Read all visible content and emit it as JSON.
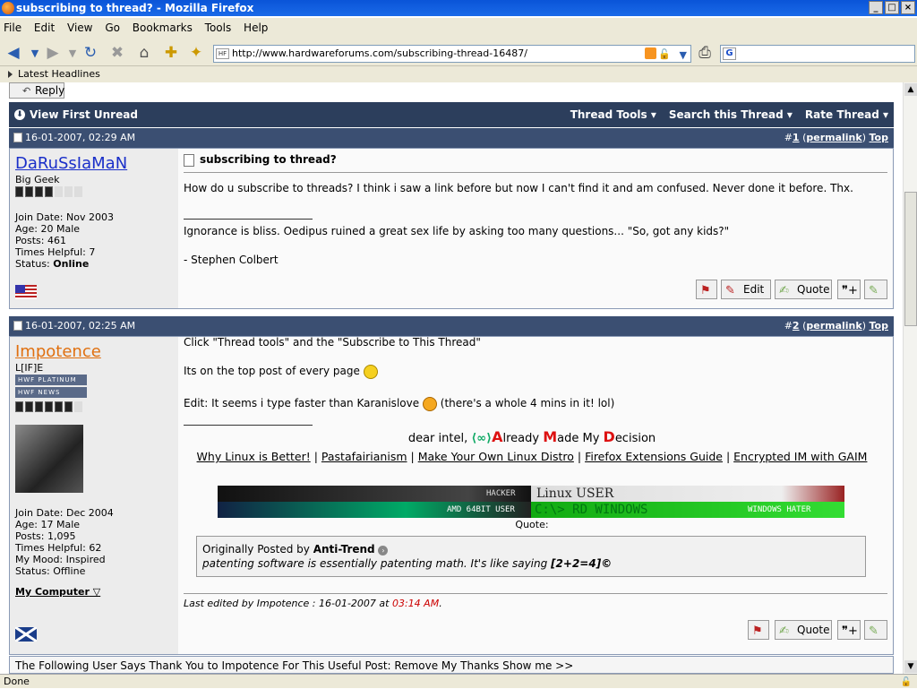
{
  "window": {
    "title": "subscribing to thread? - Mozilla Firefox"
  },
  "menu": [
    "File",
    "Edit",
    "View",
    "Go",
    "Bookmarks",
    "Tools",
    "Help"
  ],
  "address": {
    "url": "http://www.hardwareforums.com/subscribing-thread-16487/",
    "site_icon": "HF"
  },
  "search": {
    "engine_icon": "G",
    "value": ""
  },
  "bookmarks_bar": {
    "item": "Latest Headlines"
  },
  "toolbar": {
    "reply": "Reply"
  },
  "threadbar": {
    "view_first_unread": "View First Unread",
    "thread_tools": "Thread Tools",
    "search_thread": "Search this Thread",
    "rate_thread": "Rate Thread"
  },
  "posts": [
    {
      "date": "16-01-2007, 02:29 AM",
      "number": "1",
      "permalink": "permalink",
      "top": "Top",
      "username": "DaRuSsIaMaN",
      "user_title": "Big Geek",
      "rep_on": 4,
      "rep_total": 7,
      "join": "Join Date: Nov 2003",
      "age": "Age: 20 Male",
      "posts": "Posts: 461",
      "helpful": "Times Helpful: 7",
      "status_label": "Status:",
      "status": "Online",
      "subject": "subscribing to thread?",
      "body": "How do u subscribe to threads? I think i saw a link before but now I can't find it and am confused. Never done it before. Thx.",
      "sig_line1": "Ignorance is bliss. Oedipus ruined a great sex life by asking too many questions... \"So, got any kids?\"",
      "sig_line2": "- Stephen Colbert",
      "edit": "Edit",
      "quote": "Quote"
    },
    {
      "date": "16-01-2007, 02:25 AM",
      "number": "2",
      "permalink": "permalink",
      "top": "Top",
      "username": "Impotence",
      "user_title": "L[IF]E",
      "badge1": "HWF  PLATINUM",
      "badge2": "HWF   NEWS",
      "join": "Join Date: Dec 2004",
      "age": "Age: 17 Male",
      "posts": "Posts: 1,095",
      "helpful": "Times Helpful: 62",
      "mood": "My Mood: Inspired",
      "status": "Status: Offline",
      "my_computer": "My Computer",
      "line1": "Click \"Thread tools\" and the \"Subscribe to This Thread\"",
      "line2": "Its on the top post of every page",
      "line3a": "Edit: It seems i type faster than Karanislove",
      "line3b": "(there's a whole 4 mins in it! lol)",
      "sig_intel_pre": "dear intel,",
      "sig_letter_a": "A",
      "sig_word_a": "lready",
      "sig_letter_m": "M",
      "sig_word_m": "ade My",
      "sig_letter_d": "D",
      "sig_word_d": "ecision",
      "links": [
        "Why Linux is Better!",
        "Pastafairianism",
        "Make Your Own Linux Distro",
        "Firefox Extensions Guide",
        "Encrypted IM with GAIM"
      ],
      "banner1_left": "HACKER",
      "banner1_right": "Linux  USER",
      "banner2_left": "AMD  64BIT USER",
      "banner2_right": "C:\\> RD WINDOWS",
      "banner2_tag": "WINDOWS HATER",
      "quote_label": "Quote:",
      "quote_by_pre": "Originally Posted by",
      "quote_author": "Anti-Trend",
      "quote_text": "patenting software is essentially patenting math. It's like saying",
      "quote_bold": "[2+2=4]©",
      "edited_pre": "Last edited by Impotence : 16-01-2007 at",
      "edited_time": "03:14 AM",
      "edited_post": ".",
      "quote_btn": "Quote"
    }
  ],
  "thanks_bar": "The Following User Says Thank You to Impotence For This Useful Post: Remove My Thanks Show me >>",
  "status_bar": "Done",
  "colors": {
    "titlebar": "#0a54d8",
    "threadbar": "#2c3e5c",
    "postbar": "#3b4f72",
    "user1": "#1a2fc9",
    "user2": "#e07010",
    "edit_time": "#cc0000"
  }
}
